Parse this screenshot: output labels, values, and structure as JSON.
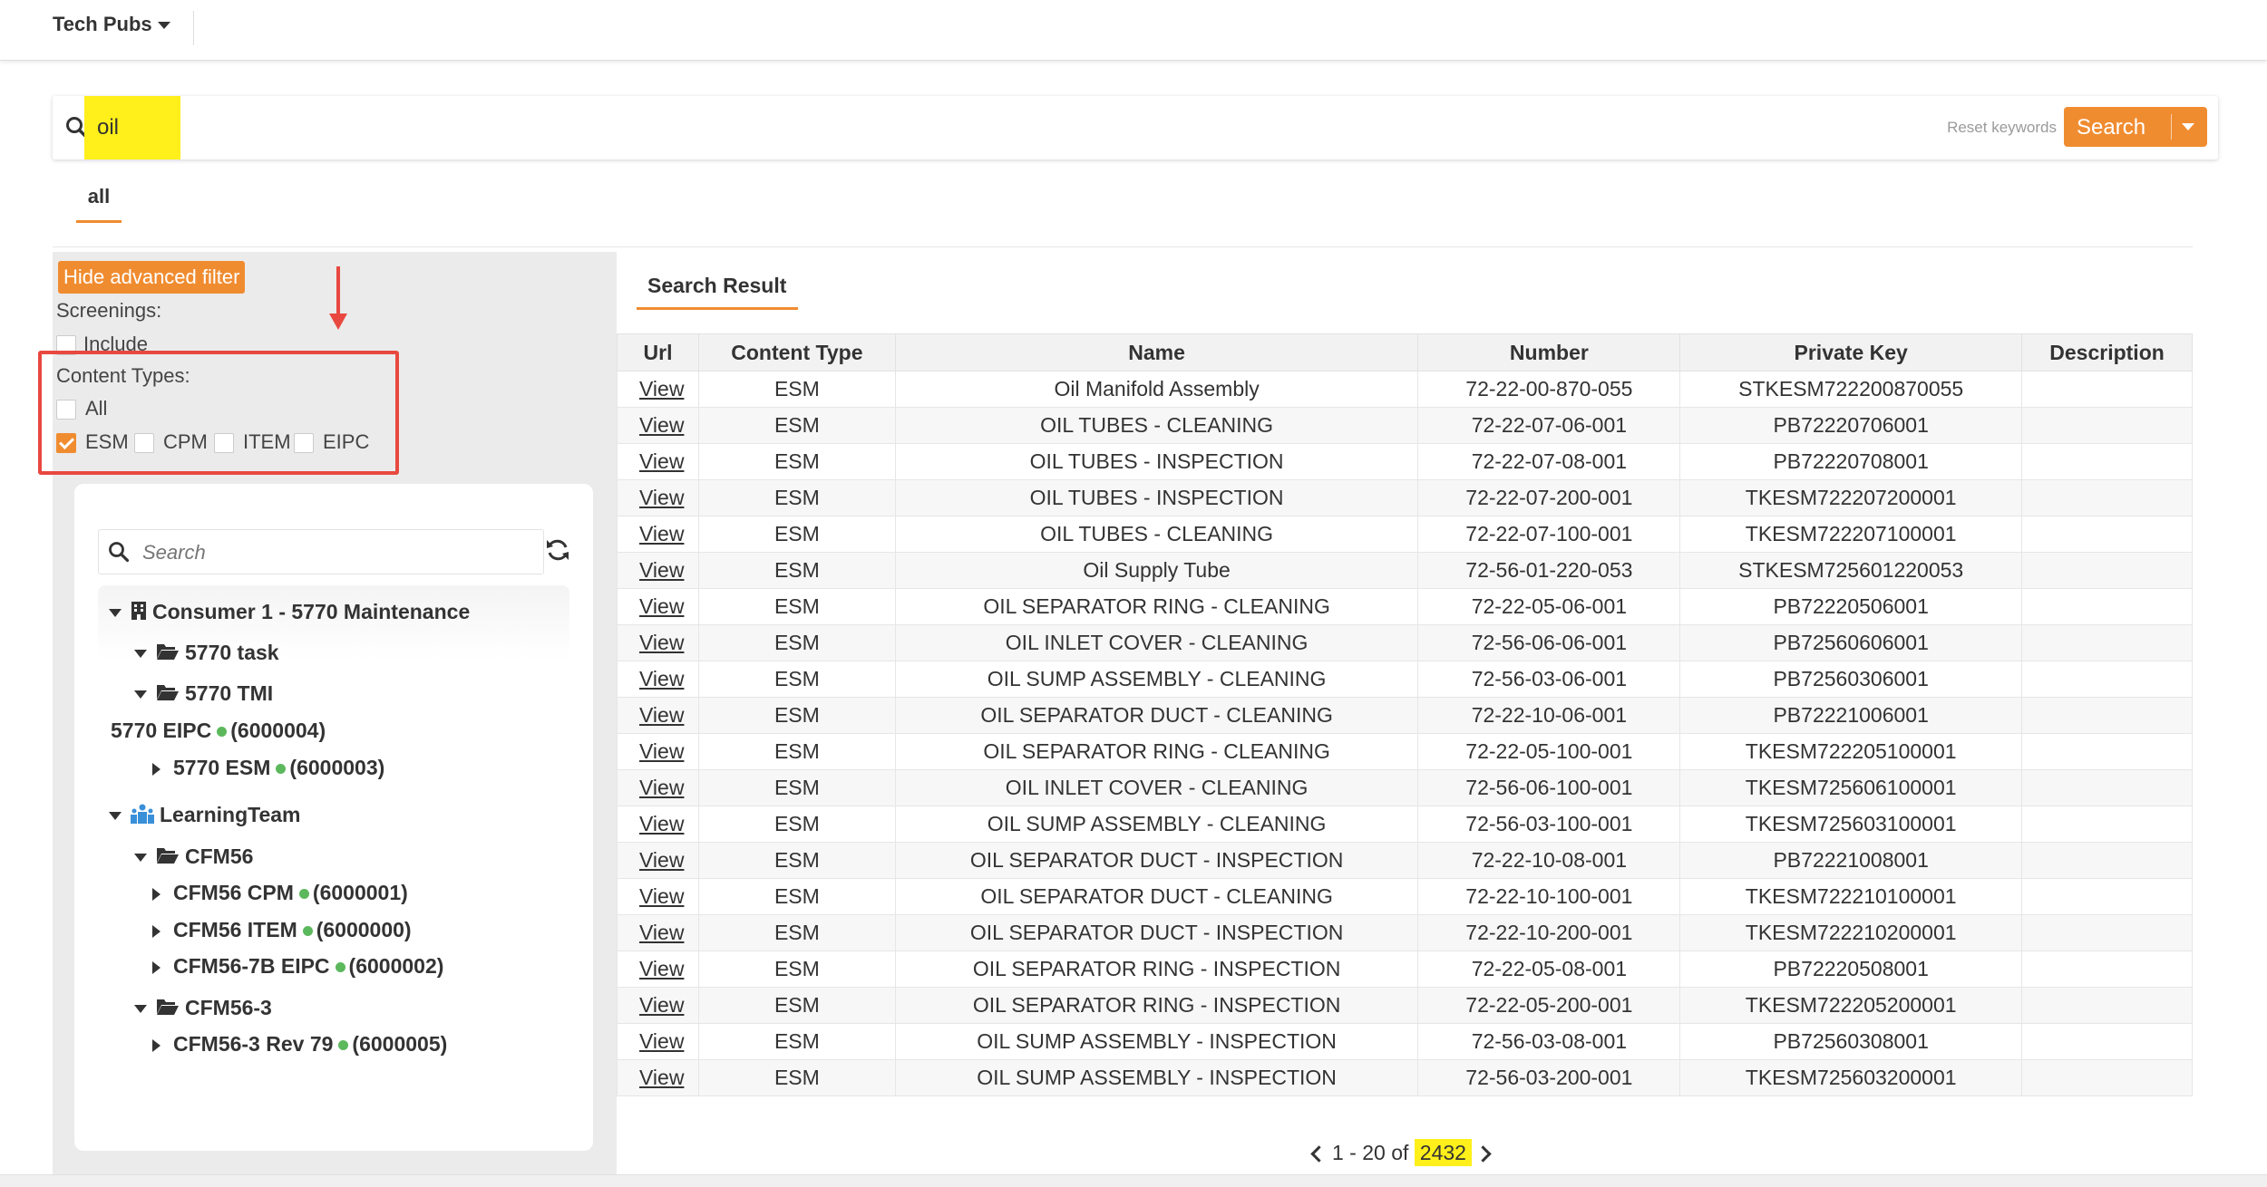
{
  "app": {
    "menu_label": "Tech Pubs"
  },
  "search": {
    "value": "oil",
    "reset_label": "Reset keywords",
    "button_label": "Search"
  },
  "tabs": {
    "all_label": "all"
  },
  "filter": {
    "hide_button_label": "Hide advanced filter",
    "screenings_label": "Screenings:",
    "include_label": "Include",
    "content_types_label": "Content Types:",
    "all_label": "All",
    "types": [
      {
        "label": "ESM",
        "checked": true
      },
      {
        "label": "CPM",
        "checked": false
      },
      {
        "label": "ITEM",
        "checked": false
      },
      {
        "label": "EIPC",
        "checked": false
      }
    ],
    "annotation_color": "#e8483f"
  },
  "tree": {
    "search_placeholder": "Search",
    "nodes": {
      "consumer": "Consumer 1 - 5770 Maintenance",
      "task": "5770 task",
      "tmi": "5770 TMI",
      "eipc_5770": "5770 EIPC",
      "eipc_5770_id": "(6000004)",
      "esm_5770": "5770 ESM",
      "esm_5770_id": "(6000003)",
      "learning": "LearningTeam",
      "cfm56": "CFM56",
      "cfm56_cpm": "CFM56 CPM",
      "cfm56_cpm_id": "(6000001)",
      "cfm56_item": "CFM56 ITEM",
      "cfm56_item_id": "(6000000)",
      "cfm56_7b": "CFM56-7B EIPC",
      "cfm56_7b_id": "(6000002)",
      "cfm56_3": "CFM56-3",
      "cfm56_3_rev": "CFM56-3 Rev 79",
      "cfm56_3_rev_id": "(6000005)"
    },
    "status_color": "#5cb85c"
  },
  "results": {
    "tab_label": "Search Result",
    "columns": [
      "Url",
      "Content Type",
      "Name",
      "Number",
      "Private Key",
      "Description"
    ],
    "link_label": "View",
    "rows": [
      [
        "ESM",
        "Oil Manifold Assembly",
        "72-22-00-870-055",
        "STKESM722200870055",
        ""
      ],
      [
        "ESM",
        "OIL TUBES - CLEANING",
        "72-22-07-06-001",
        "PB72220706001",
        ""
      ],
      [
        "ESM",
        "OIL TUBES - INSPECTION",
        "72-22-07-08-001",
        "PB72220708001",
        ""
      ],
      [
        "ESM",
        "OIL TUBES - INSPECTION",
        "72-22-07-200-001",
        "TKESM722207200001",
        ""
      ],
      [
        "ESM",
        "OIL TUBES - CLEANING",
        "72-22-07-100-001",
        "TKESM722207100001",
        ""
      ],
      [
        "ESM",
        "Oil Supply Tube",
        "72-56-01-220-053",
        "STKESM725601220053",
        ""
      ],
      [
        "ESM",
        "OIL SEPARATOR RING - CLEANING",
        "72-22-05-06-001",
        "PB72220506001",
        ""
      ],
      [
        "ESM",
        "OIL INLET COVER - CLEANING",
        "72-56-06-06-001",
        "PB72560606001",
        ""
      ],
      [
        "ESM",
        "OIL SUMP ASSEMBLY - CLEANING",
        "72-56-03-06-001",
        "PB72560306001",
        ""
      ],
      [
        "ESM",
        "OIL SEPARATOR DUCT - CLEANING",
        "72-22-10-06-001",
        "PB72221006001",
        ""
      ],
      [
        "ESM",
        "OIL SEPARATOR RING - CLEANING",
        "72-22-05-100-001",
        "TKESM722205100001",
        ""
      ],
      [
        "ESM",
        "OIL INLET COVER - CLEANING",
        "72-56-06-100-001",
        "TKESM725606100001",
        ""
      ],
      [
        "ESM",
        "OIL SUMP ASSEMBLY - CLEANING",
        "72-56-03-100-001",
        "TKESM725603100001",
        ""
      ],
      [
        "ESM",
        "OIL SEPARATOR DUCT - INSPECTION",
        "72-22-10-08-001",
        "PB72221008001",
        ""
      ],
      [
        "ESM",
        "OIL SEPARATOR DUCT - CLEANING",
        "72-22-10-100-001",
        "TKESM722210100001",
        ""
      ],
      [
        "ESM",
        "OIL SEPARATOR DUCT - INSPECTION",
        "72-22-10-200-001",
        "TKESM722210200001",
        ""
      ],
      [
        "ESM",
        "OIL SEPARATOR RING - INSPECTION",
        "72-22-05-08-001",
        "PB72220508001",
        ""
      ],
      [
        "ESM",
        "OIL SEPARATOR RING - INSPECTION",
        "72-22-05-200-001",
        "TKESM722205200001",
        ""
      ],
      [
        "ESM",
        "OIL SUMP ASSEMBLY - INSPECTION",
        "72-56-03-08-001",
        "PB72560308001",
        ""
      ],
      [
        "ESM",
        "OIL SUMP ASSEMBLY - INSPECTION",
        "72-56-03-200-001",
        "TKESM725603200001",
        ""
      ]
    ]
  },
  "pagination": {
    "range": "1 - 20 of",
    "total": "2432"
  },
  "colors": {
    "accent": "#f08c30",
    "highlight": "#ffef1a"
  }
}
